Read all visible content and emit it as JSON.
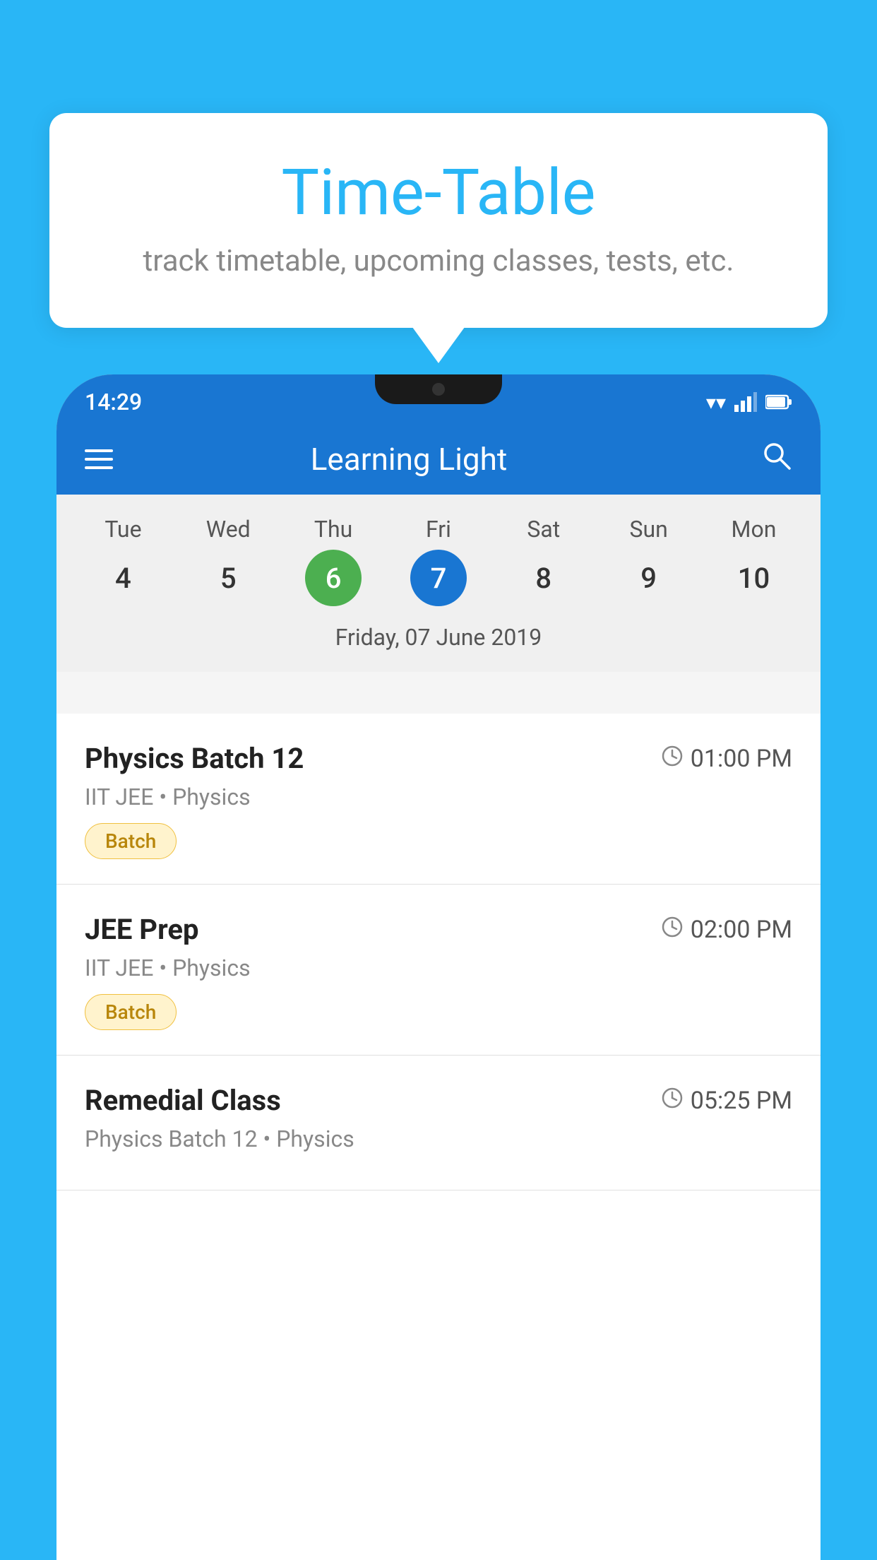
{
  "background_color": "#29B6F6",
  "tooltip": {
    "title": "Time-Table",
    "subtitle": "track timetable, upcoming classes, tests, etc."
  },
  "app": {
    "title": "Learning Light",
    "status_time": "14:29"
  },
  "calendar": {
    "days": [
      {
        "label": "Tue",
        "number": "4",
        "state": "normal"
      },
      {
        "label": "Wed",
        "number": "5",
        "state": "normal"
      },
      {
        "label": "Thu",
        "number": "6",
        "state": "today"
      },
      {
        "label": "Fri",
        "number": "7",
        "state": "selected"
      },
      {
        "label": "Sat",
        "number": "8",
        "state": "normal"
      },
      {
        "label": "Sun",
        "number": "9",
        "state": "normal"
      },
      {
        "label": "Mon",
        "number": "10",
        "state": "normal"
      }
    ],
    "selected_date_label": "Friday, 07 June 2019"
  },
  "schedule": [
    {
      "title": "Physics Batch 12",
      "time": "01:00 PM",
      "subtitle": "IIT JEE • Physics",
      "badge": "Batch"
    },
    {
      "title": "JEE Prep",
      "time": "02:00 PM",
      "subtitle": "IIT JEE • Physics",
      "badge": "Batch"
    },
    {
      "title": "Remedial Class",
      "time": "05:25 PM",
      "subtitle": "Physics Batch 12 • Physics",
      "badge": null
    }
  ]
}
